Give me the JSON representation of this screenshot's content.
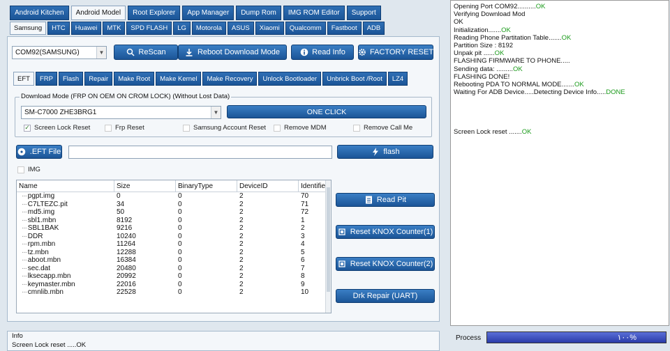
{
  "top_tabs": [
    "Android Kitchen",
    "Android Model",
    "Root Explorer",
    "App Manager",
    "Dump Rom",
    "IMG ROM Editor",
    "Support"
  ],
  "brand_tabs": [
    "Samsung",
    "HTC",
    "Huawei",
    "MTK",
    "SPD FLASH",
    "LG",
    "Motorola",
    "ASUS",
    "Xiaomi",
    "Qualcomm",
    "Fastboot",
    "ADB"
  ],
  "port_combo": "COM92(SAMSUNG)",
  "toolbar": {
    "rescan": "ReScan",
    "reboot_download": "Reboot  Download Mode",
    "read_info": "Read Info",
    "factory_reset": "FACTORY RESET"
  },
  "sub_tabs": [
    "EFT",
    "FRP",
    "Flash",
    "Repair",
    "Make Root",
    "Make Kernel",
    "Make Recovery",
    "Unlock Bootloader",
    "Unbrick Boot /Root",
    "LZ4"
  ],
  "download_group": {
    "title": "Download Mode (FRP ON OEM ON CROM LOCK) (Without Lost Data)",
    "model": "SM-C7000  ZHE3BRG1",
    "one_click": "ONE CLICK",
    "options": [
      {
        "label": "Screen Lock  Reset",
        "checked": true
      },
      {
        "label": "Frp Reset",
        "checked": false
      },
      {
        "label": "Samsung Account  Reset",
        "checked": false
      },
      {
        "label": "Remove  MDM",
        "checked": false
      },
      {
        "label": "Remove Call Me",
        "checked": false
      }
    ]
  },
  "eft_file_button": ".EFT File",
  "eft_file_path": "",
  "flash_button": "flash",
  "img_checkbox": "IMG",
  "table": {
    "headers": [
      "Name",
      "Size",
      "BinaryType",
      "DeviceID",
      "Identifie"
    ],
    "rows": [
      [
        "pgpt.img",
        "0",
        "0",
        "2",
        "70"
      ],
      [
        "C7LTEZC.pit",
        "34",
        "0",
        "2",
        "71"
      ],
      [
        "md5.img",
        "50",
        "0",
        "2",
        "72"
      ],
      [
        "sbl1.mbn",
        "8192",
        "0",
        "2",
        "1"
      ],
      [
        "SBL1BAK",
        "9216",
        "0",
        "2",
        "2"
      ],
      [
        "DDR",
        "10240",
        "0",
        "2",
        "3"
      ],
      [
        "rpm.mbn",
        "11264",
        "0",
        "2",
        "4"
      ],
      [
        "tz.mbn",
        "12288",
        "0",
        "2",
        "5"
      ],
      [
        "aboot.mbn",
        "16384",
        "0",
        "2",
        "6"
      ],
      [
        "sec.dat",
        "20480",
        "0",
        "2",
        "7"
      ],
      [
        "lksecapp.mbn",
        "20992",
        "0",
        "2",
        "8"
      ],
      [
        "keymaster.mbn",
        "22016",
        "0",
        "2",
        "9"
      ],
      [
        "cmnlib.mbn",
        "22528",
        "0",
        "2",
        "10"
      ]
    ]
  },
  "side_buttons": {
    "read_pit": "Read Pit",
    "reset_knox_1": "Reset KNOX Counter(1)",
    "reset_knox_2": "Reset KNOX Counter(2)",
    "drk_repair": "Drk Repair (UART)"
  },
  "info": {
    "title": "Info",
    "text": "Screen Lock reset .....OK"
  },
  "log_lines": [
    {
      "text": "Opening Port COM92..........",
      "ok": "OK"
    },
    {
      "text": "Verifying Download Mod",
      "ok": ""
    },
    {
      "text": "OK",
      "ok": ""
    },
    {
      "text": "Initialization.......",
      "ok": "OK"
    },
    {
      "text": "Reading Phone Partitation Table.......",
      "ok": "OK"
    },
    {
      "text": "Partition Size : 8192",
      "ok": ""
    },
    {
      "text": "Unpak pit ......",
      "ok": "OK"
    },
    {
      "text": "FLASHING FIRMWARE TO PHONE.....",
      "ok": ""
    },
    {
      "text": "Sending data: .........",
      "ok": "OK"
    },
    {
      "text": "FLASHING DONE!",
      "ok": ""
    },
    {
      "text": "Rebooting PDA TO NORMAL MODE.......",
      "ok": "OK"
    },
    {
      "text": "Waiting For ADB Device.....Detecting Device Info.....",
      "ok": "DONE"
    }
  ],
  "log_footer": {
    "text": "Screen Lock reset .......",
    "ok": "OK"
  },
  "process": {
    "label": "Process",
    "percent_text": "١٠٠%",
    "value": 100
  }
}
